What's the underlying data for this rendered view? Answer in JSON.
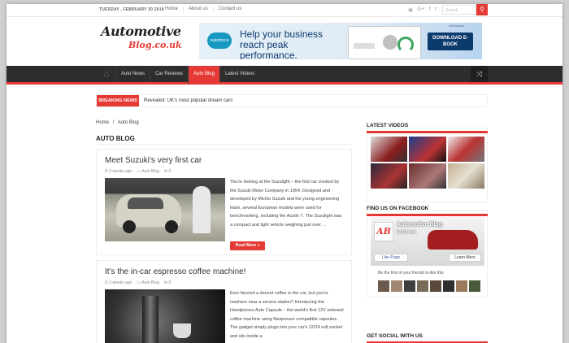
{
  "topbar": {
    "date": "TUESDAY , FEBRUARY 20 2018",
    "links": [
      "Home",
      "About us",
      "Contact us"
    ],
    "search_placeholder": "Search",
    "social_icons": [
      "rss-icon",
      "google-plus-icon",
      "facebook-icon",
      "twitter-icon"
    ]
  },
  "logo": {
    "line1_a": "Automotive",
    "line2": "Blog.co.uk"
  },
  "ad": {
    "brand": "salesforce",
    "headline": "Help your business reach peak performance.",
    "cta": "DOWNLOAD E-BOOK",
    "adchoices": "AdChoices"
  },
  "nav": {
    "items": [
      "Auto News",
      "Car Reviews",
      "Auto Blog",
      "Latest Videos"
    ],
    "active": "Auto Blog"
  },
  "breaking": {
    "label": "BREAKING NEWS",
    "text": "Revealed: UK's most popular dream cars"
  },
  "breadcrumb": {
    "home": "Home",
    "sep": "/",
    "current": "Auto Blog"
  },
  "page_title": "AUTO BLOG",
  "posts": [
    {
      "title": "Meet Suzuki's very first car",
      "date": "2 weeks ago",
      "category": "Auto Blog",
      "comments": "0",
      "excerpt": "You're looking at the Suzulight – the first car created by the Suzuki Motor Company in 1954. Designed and developed by Michio Suzuki and his young engineering team, several European models were used for benchmarking, including the Austin 7. The Suzulight was a compact and light vehicle weighing just over ...",
      "more": "Read More »"
    },
    {
      "title": "It's the in-car espresso coffee machine!",
      "date": "2 weeks ago",
      "category": "Auto Blog",
      "comments": "0",
      "excerpt": "Ever fancied a decent coffee in the car, but you're nowhere near a service station? Introducing the Handpresso Auto Capsule – the world's first 12V onboard coffee machine using Nespresso compatible capsules. The gadget simply plugs into your car's 12/24 volt socket and sits inside a"
    }
  ],
  "sidebar": {
    "latest_videos_title": "LATEST VIDEOS",
    "video_thumb_colors": [
      "#8b1d1d",
      "#1d3f8b",
      "#b33",
      "#2b2b3b",
      "#6a2f2f",
      "#c2b090"
    ],
    "facebook_title": "FIND US ON FACEBOOK",
    "fb_page": "Automotive Blog",
    "fb_likes": "8,823 likes",
    "fb_like_btn": "Like Page",
    "fb_learn_btn": "Learn More",
    "fb_friends": "Be the first of your friends to like this",
    "social_title": "GET SOCIAL WITH US"
  }
}
